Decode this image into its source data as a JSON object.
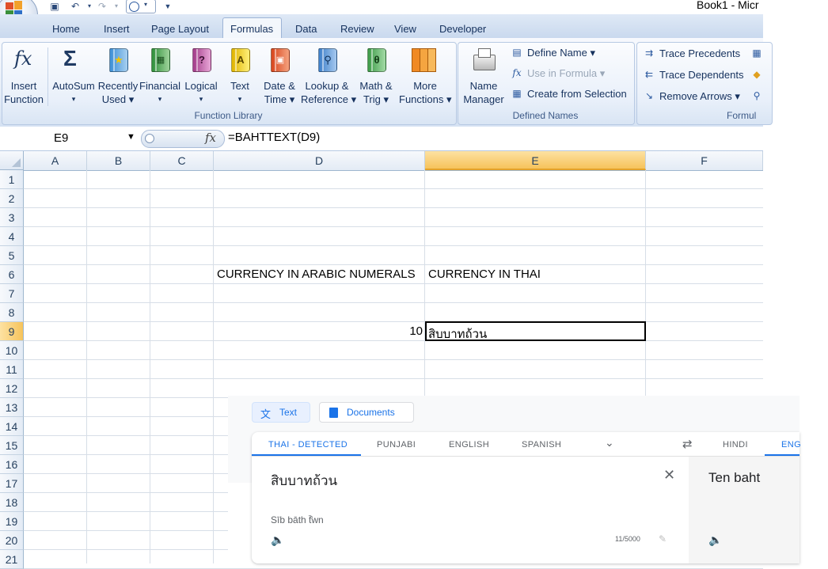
{
  "title": "Book1 - Micr",
  "tabs": [
    "Home",
    "Insert",
    "Page Layout",
    "Formulas",
    "Data",
    "Review",
    "View",
    "Developer"
  ],
  "active_tab": "Formulas",
  "ribbon": {
    "insert_function": [
      "Insert",
      "Function"
    ],
    "library_buttons": [
      {
        "l1": "AutoSum",
        "l2": "▾"
      },
      {
        "l1": "Recently",
        "l2": "Used ▾"
      },
      {
        "l1": "Financial",
        "l2": "▾"
      },
      {
        "l1": "Logical",
        "l2": "▾"
      },
      {
        "l1": "Text",
        "l2": "▾"
      },
      {
        "l1": "Date &",
        "l2": "Time ▾"
      },
      {
        "l1": "Lookup &",
        "l2": "Reference ▾"
      },
      {
        "l1": "Math &",
        "l2": "Trig ▾"
      },
      {
        "l1": "More",
        "l2": "Functions ▾"
      }
    ],
    "function_library_label": "Function Library",
    "name_manager": [
      "Name",
      "Manager"
    ],
    "define_name": "Define Name ▾",
    "use_in_formula": "Use in Formula ▾",
    "create_from_selection": "Create from Selection",
    "defined_names_label": "Defined Names",
    "trace_precedents": "Trace Precedents",
    "trace_dependents": "Trace Dependents",
    "remove_arrows": "Remove Arrows ▾",
    "formula_auditing_label": "Formul"
  },
  "formula_bar": {
    "name_box": "E9",
    "fx": "fx",
    "formula": "=BAHTTEXT(D9)"
  },
  "columns": [
    "A",
    "B",
    "C",
    "D",
    "E",
    "F"
  ],
  "rows": [
    "1",
    "2",
    "3",
    "4",
    "5",
    "6",
    "7",
    "8",
    "9",
    "10",
    "11",
    "12",
    "13",
    "14",
    "15",
    "16",
    "17",
    "18",
    "19",
    "20",
    "21"
  ],
  "cells": {
    "D6": "CURRENCY IN ARABIC NUMERALS",
    "E6": "CURRENCY IN THAI",
    "D9": "10",
    "E9": "สิบบาทถ้วน"
  },
  "translate": {
    "mode_tabs": [
      "Text",
      "Documents"
    ],
    "source_langs": [
      "THAI - DETECTED",
      "PUNJABI",
      "ENGLISH",
      "SPANISH"
    ],
    "target_langs": [
      "HINDI",
      "ENG"
    ],
    "source_text": "สิบบาทถ้วน",
    "romanization": "Sīb bāth t̄̂wn",
    "char_count": "11/5000",
    "translation": "Ten baht",
    "colors": {
      "accent": "#1a73e8",
      "active_tab_bg": "#e8f0fe"
    }
  }
}
